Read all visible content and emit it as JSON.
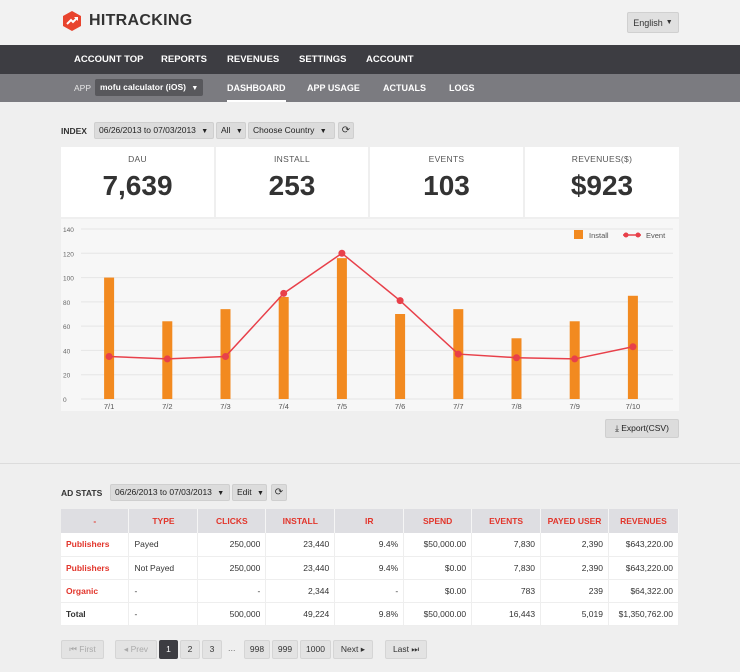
{
  "header": {
    "brand": "HITRACKING",
    "language": "English"
  },
  "nav": {
    "main": [
      "ACCOUNT TOP",
      "REPORTS",
      "REVENUES",
      "SETTINGS",
      "ACCOUNT"
    ],
    "app_label": "APP",
    "app_selected": "mofu calculator (iOS)",
    "sub": [
      "DASHBOARD",
      "APP USAGE",
      "ACTUALS",
      "LOGS"
    ],
    "active_sub": "DASHBOARD"
  },
  "index_filter": {
    "label": "INDEX",
    "date_range": "06/26/2013 to 07/03/2013",
    "segment": "All",
    "country": "Choose Country"
  },
  "stats": [
    {
      "label": "DAU",
      "value": "7,639"
    },
    {
      "label": "INSTALL",
      "value": "253"
    },
    {
      "label": "EVENTS",
      "value": "103"
    },
    {
      "label": "REVENUES($)",
      "value": "$923"
    }
  ],
  "chart_data": {
    "type": "bar",
    "categories": [
      "7/1",
      "7/2",
      "7/3",
      "7/4",
      "7/5",
      "7/6",
      "7/7",
      "7/8",
      "7/9",
      "7/10"
    ],
    "series": [
      {
        "name": "Install",
        "type": "bar",
        "color": "#f28a20",
        "values": [
          100,
          64,
          74,
          84,
          116,
          70,
          74,
          50,
          64,
          85
        ]
      },
      {
        "name": "Event",
        "type": "line",
        "color": "#e8404a",
        "values": [
          35,
          33,
          35,
          87,
          120,
          81,
          37,
          34,
          33,
          43
        ]
      }
    ],
    "ylim": [
      0,
      140
    ],
    "yticks": [
      0,
      20,
      40,
      60,
      80,
      100,
      120,
      140
    ],
    "legend_position": "top-right",
    "grid": true
  },
  "export_label": "Export(CSV)",
  "ad_stats": {
    "label": "AD STATS",
    "date_range": "06/26/2013 to 07/03/2013",
    "edit_label": "Edit",
    "columns": [
      "-",
      "TYPE",
      "CLICKS",
      "INSTALL",
      "IR",
      "SPEND",
      "EVENTS",
      "PAYED USER",
      "REVENUES"
    ],
    "rows": [
      [
        "Publishers",
        "Payed",
        "250,000",
        "23,440",
        "9.4%",
        "$50,000.00",
        "7,830",
        "2,390",
        "$643,220.00"
      ],
      [
        "Publishers",
        "Not Payed",
        "250,000",
        "23,440",
        "9.4%",
        "$0.00",
        "7,830",
        "2,390",
        "$643,220.00"
      ],
      [
        "Organic",
        "-",
        "-",
        "2,344",
        "-",
        "$0.00",
        "783",
        "239",
        "$64,322.00"
      ],
      [
        "Total",
        "-",
        "500,000",
        "49,224",
        "9.8%",
        "$50,000.00",
        "16,443",
        "5,019",
        "$1,350,762.00"
      ]
    ]
  },
  "pagination": {
    "first": "First",
    "prev": "Prev",
    "pages_start": [
      "1",
      "2",
      "3"
    ],
    "ellipsis": "...",
    "pages_end": [
      "998",
      "999",
      "1000"
    ],
    "next": "Next",
    "last": "Last",
    "current": "1"
  },
  "colors": {
    "accent": "#e2352b",
    "install": "#f28a20",
    "event": "#e8404a",
    "nav_dark": "#3d3d42",
    "nav_sub": "#7b7b80"
  }
}
